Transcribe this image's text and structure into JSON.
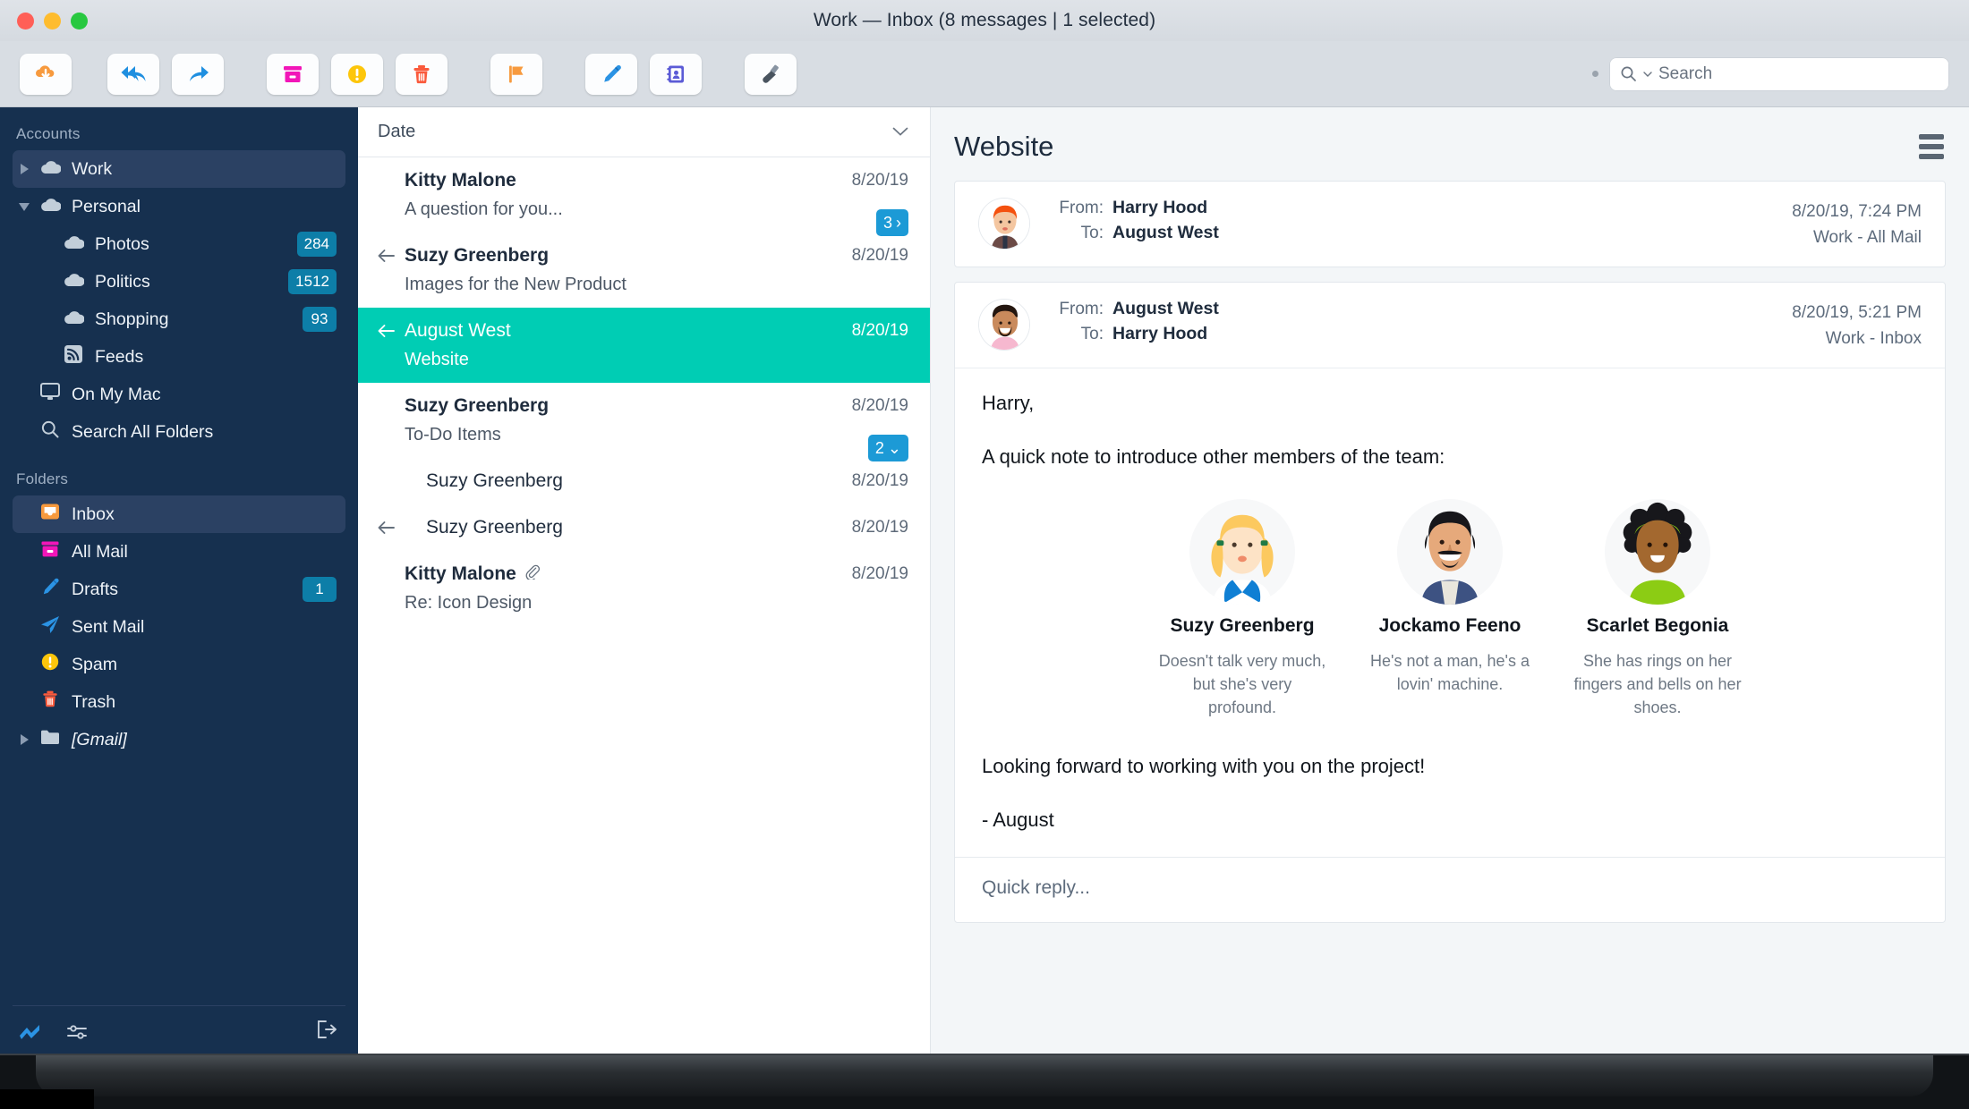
{
  "window": {
    "title": "Work — Inbox (8 messages | 1 selected)"
  },
  "toolbar": {
    "buttons": [
      {
        "name": "get-mail-button",
        "icon": "cloud-download-icon"
      },
      {
        "name": "reply-all-button",
        "icon": "reply-all-icon"
      },
      {
        "name": "forward-button",
        "icon": "forward-arrow-icon"
      },
      {
        "name": "archive-button",
        "icon": "archive-box-icon"
      },
      {
        "name": "junk-button",
        "icon": "warning-circle-icon"
      },
      {
        "name": "delete-button",
        "icon": "trash-icon"
      },
      {
        "name": "flag-button",
        "icon": "flag-icon"
      },
      {
        "name": "compose-button",
        "icon": "pencil-icon"
      },
      {
        "name": "contacts-button",
        "icon": "address-card-icon"
      },
      {
        "name": "cleanup-button",
        "icon": "paintbrush-icon"
      }
    ],
    "search": {
      "placeholder": "Search",
      "icon": "search-icon"
    }
  },
  "sidebar": {
    "accounts_title": "Accounts",
    "folders_title": "Folders",
    "accounts": [
      {
        "label": "Work",
        "icon": "cloud-icon",
        "twisty": "right",
        "indent": 0,
        "selected": true,
        "badge": ""
      },
      {
        "label": "Personal",
        "icon": "cloud-icon",
        "twisty": "down",
        "indent": 0,
        "selected": false,
        "badge": ""
      },
      {
        "label": "Photos",
        "icon": "cloud-icon",
        "twisty": "",
        "indent": 1,
        "selected": false,
        "badge": "284"
      },
      {
        "label": "Politics",
        "icon": "cloud-icon",
        "twisty": "",
        "indent": 1,
        "selected": false,
        "badge": "1512"
      },
      {
        "label": "Shopping",
        "icon": "cloud-icon",
        "twisty": "",
        "indent": 1,
        "selected": false,
        "badge": "93"
      },
      {
        "label": "Feeds",
        "icon": "rss-icon",
        "twisty": "",
        "indent": 1,
        "selected": false,
        "badge": ""
      },
      {
        "label": "On My Mac",
        "icon": "monitor-icon",
        "twisty": "",
        "indent": 0,
        "selected": false,
        "badge": ""
      },
      {
        "label": "Search All Folders",
        "icon": "search-icon",
        "twisty": "",
        "indent": 0,
        "selected": false,
        "badge": ""
      }
    ],
    "folders": [
      {
        "label": "Inbox",
        "icon": "inbox-icon",
        "twisty": "",
        "indent": 0,
        "selected": true,
        "badge": "",
        "italic": false
      },
      {
        "label": "All Mail",
        "icon": "allmail-icon",
        "twisty": "",
        "indent": 0,
        "selected": false,
        "badge": "",
        "italic": false
      },
      {
        "label": "Drafts",
        "icon": "pencil-icon",
        "twisty": "",
        "indent": 0,
        "selected": false,
        "badge": "1",
        "italic": false
      },
      {
        "label": "Sent Mail",
        "icon": "paper-plane-icon",
        "twisty": "",
        "indent": 0,
        "selected": false,
        "badge": "",
        "italic": false
      },
      {
        "label": "Spam",
        "icon": "warning-circle-icon",
        "twisty": "",
        "indent": 0,
        "selected": false,
        "badge": "",
        "italic": false
      },
      {
        "label": "Trash",
        "icon": "trash-icon",
        "twisty": "",
        "indent": 0,
        "selected": false,
        "badge": "",
        "italic": false
      },
      {
        "label": "[Gmail]",
        "icon": "folder-icon",
        "twisty": "right",
        "indent": 0,
        "selected": false,
        "badge": "",
        "italic": true
      }
    ],
    "footer": [
      {
        "name": "activity-icon"
      },
      {
        "name": "filter-sliders-icon"
      },
      {
        "name": "logout-icon"
      }
    ]
  },
  "message_list": {
    "sort_label": "Date",
    "sort_icon": "chevron-down-icon",
    "rows": [
      {
        "sender": "Kitty Malone",
        "subject": "A question for you...",
        "date": "8/20/19",
        "replied": false,
        "attachment": false,
        "count": "3",
        "count_icon": "›",
        "indent": false,
        "selected": false
      },
      {
        "sender": "Suzy Greenberg",
        "subject": "Images for the New Product",
        "date": "8/20/19",
        "replied": true,
        "attachment": false,
        "count": "",
        "count_icon": "",
        "indent": false,
        "selected": false
      },
      {
        "sender": "August West",
        "subject": "Website",
        "date": "8/20/19",
        "replied": true,
        "attachment": false,
        "count": "",
        "count_icon": "",
        "indent": false,
        "selected": true
      },
      {
        "sender": "Suzy Greenberg",
        "subject": "To-Do Items",
        "date": "8/20/19",
        "replied": false,
        "attachment": false,
        "count": "2",
        "count_icon": "⌄",
        "indent": false,
        "selected": false
      },
      {
        "sender": "Suzy Greenberg",
        "subject": "",
        "date": "8/20/19",
        "replied": false,
        "attachment": false,
        "count": "",
        "count_icon": "",
        "indent": true,
        "selected": false
      },
      {
        "sender": "Suzy Greenberg",
        "subject": "",
        "date": "8/20/19",
        "replied": true,
        "attachment": false,
        "count": "",
        "count_icon": "",
        "indent": true,
        "selected": false
      },
      {
        "sender": "Kitty Malone",
        "subject": "Re: Icon Design",
        "date": "8/20/19",
        "replied": false,
        "attachment": true,
        "count": "",
        "count_icon": "",
        "indent": false,
        "selected": false
      }
    ]
  },
  "reader": {
    "title": "Website",
    "menu_icon": "hamburger-icon",
    "messages": [
      {
        "from_label": "From:",
        "from": "Harry Hood",
        "to_label": "To:",
        "to": "August West",
        "datetime": "8/20/19, 7:24 PM",
        "mailbox": "Work - All Mail",
        "avatar": "harry-hood-avatar"
      },
      {
        "from_label": "From:",
        "from": "August West",
        "to_label": "To:",
        "to": "Harry Hood",
        "datetime": "8/20/19, 5:21 PM",
        "mailbox": "Work - Inbox",
        "avatar": "august-west-avatar"
      }
    ],
    "body": {
      "greeting": "Harry,",
      "intro": "A quick note to introduce other members of the team:",
      "closing": "Looking forward to working with you on the project!",
      "signature": "- August",
      "team": [
        {
          "name": "Suzy Greenberg",
          "desc": "Doesn't talk very much, but she's very profound.",
          "avatar": "suzy-greenberg-avatar"
        },
        {
          "name": "Jockamo Feeno",
          "desc": "He's not a man, he's a lovin' machine.",
          "avatar": "jockamo-feeno-avatar"
        },
        {
          "name": "Scarlet Begonia",
          "desc": "She has rings on her fingers and bells on her shoes.",
          "avatar": "scarlet-begonia-avatar"
        }
      ]
    },
    "quick_reply": "Quick reply..."
  },
  "colors": {
    "sidebar_bg": "#16304f",
    "selection_teal": "#00cdb4",
    "badge_blue": "#0d7ea8",
    "count_blue": "#1c9ad6"
  }
}
